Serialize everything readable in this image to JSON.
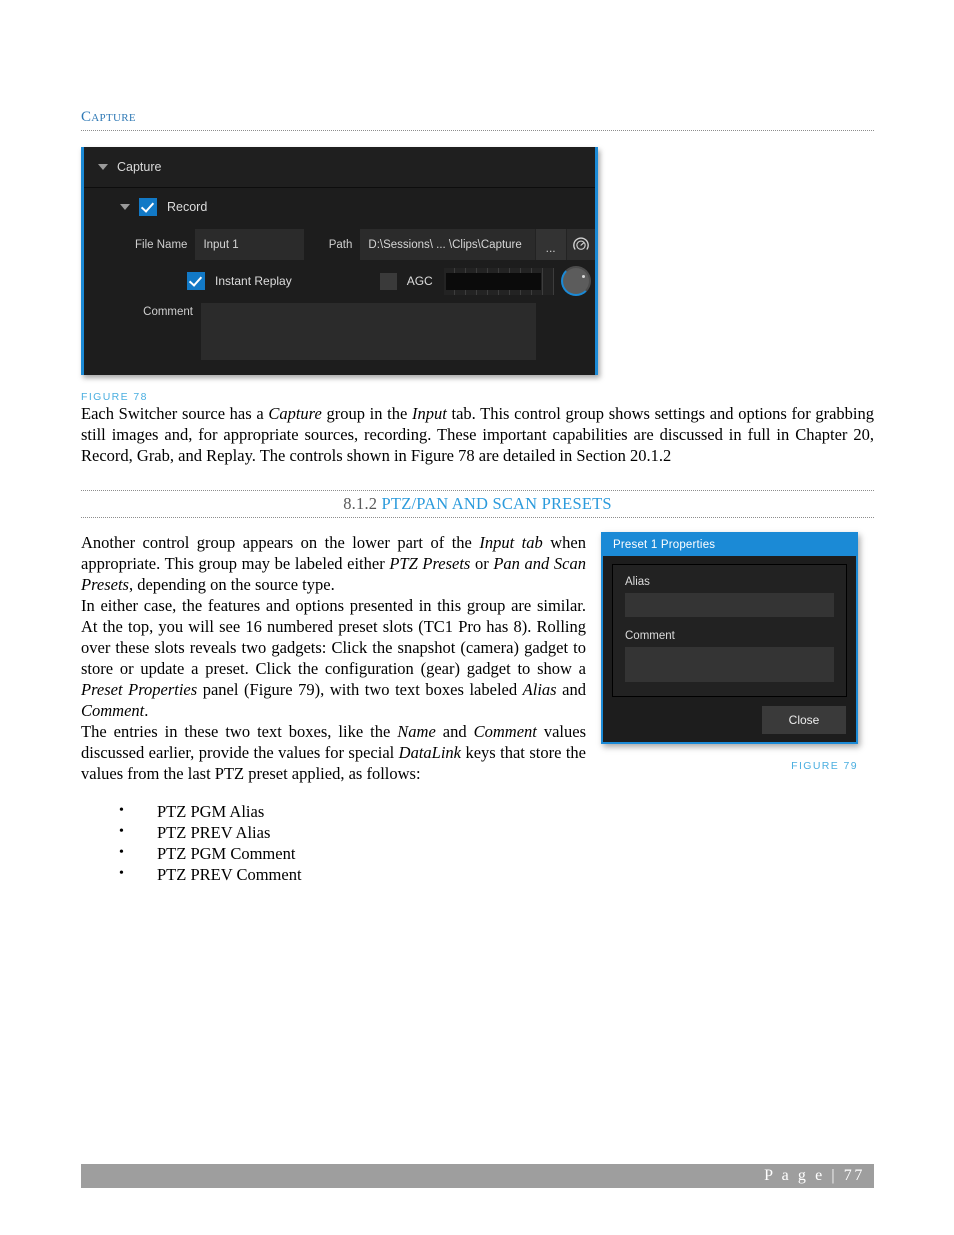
{
  "running_head": "Capture",
  "figure78": {
    "caption": "FIGURE 78",
    "panel_title": "Capture",
    "record_label": "Record",
    "file_name_label": "File Name",
    "file_name_value": "Input 1",
    "path_label": "Path",
    "path_value": "D:\\Sessions\\ ... \\Clips\\Capture",
    "browse_label": "...",
    "gauge_icon": "gauge-icon",
    "instant_replay_label": "Instant Replay",
    "agc_label": "AGC",
    "comment_label": "Comment",
    "comment_value": ""
  },
  "paragraphs": {
    "intro": {
      "run1": "Each Switcher source has a ",
      "em1": "Capture",
      "run2": " group in the ",
      "em2": "Input",
      "run3": " tab.  This control group shows settings and options for grabbing still images and, for appropriate sources, recording.   These important capabilities are discussed in full in Chapter 20, Record, Grab, and Replay.  The controls shown in  Figure 78 are detailed in Section 20.1.2"
    },
    "p1": {
      "run1": "Another control group appears on the lower part of the ",
      "em1": "Input tab",
      "run2": " when appropriate.  This group may be labeled either ",
      "em2": "PTZ Presets",
      "run3": " or ",
      "em3": "Pan and Scan Presets",
      "run4": ", depending on the source type."
    },
    "p2": {
      "run1": "In either case, the features and options presented in this group are similar.  At the top, you will see 16 numbered preset slots (TC1 Pro has 8).   Rolling over these slots reveals two gadgets: Click the snapshot (camera) gadget to store or update a preset.  Click the configuration (gear) gadget to show a ",
      "em1": "Preset Properties",
      "run2": " panel (Figure 79), with two text boxes labeled ",
      "em2": "Alias",
      "run3": " and ",
      "em3": "Comment",
      "run4": "."
    },
    "p3": {
      "run1": "The entries in these two text boxes, like the ",
      "em1": "Name",
      "run2": " and ",
      "em2": "Comment",
      "run3": " values discussed earlier, provide the values for special ",
      "em3": "DataLink",
      "run4": " keys that store the values from the last PTZ preset applied, as follows:"
    }
  },
  "section_heading": {
    "number": "8.1.2",
    "title": "PTZ/Pan and Scan Presets"
  },
  "figure79": {
    "caption": "FIGURE 79",
    "title": "Preset 1 Properties",
    "alias_label": "Alias",
    "alias_value": "",
    "comment_label": "Comment",
    "comment_value": "",
    "close_label": "Close"
  },
  "bullets": [
    "PTZ PGM Alias",
    "PTZ PREV Alias",
    "PTZ PGM Comment",
    "PTZ PREV Comment"
  ],
  "footer": {
    "text": "P a g e  | 77"
  },
  "colors": {
    "accent_blue": "#1b8ad6",
    "heading_blue": "#2c9bdc",
    "caption_blue": "#4aaee0",
    "runhead_blue": "#2f79b5",
    "footer_gray": "#9e9e9e"
  }
}
